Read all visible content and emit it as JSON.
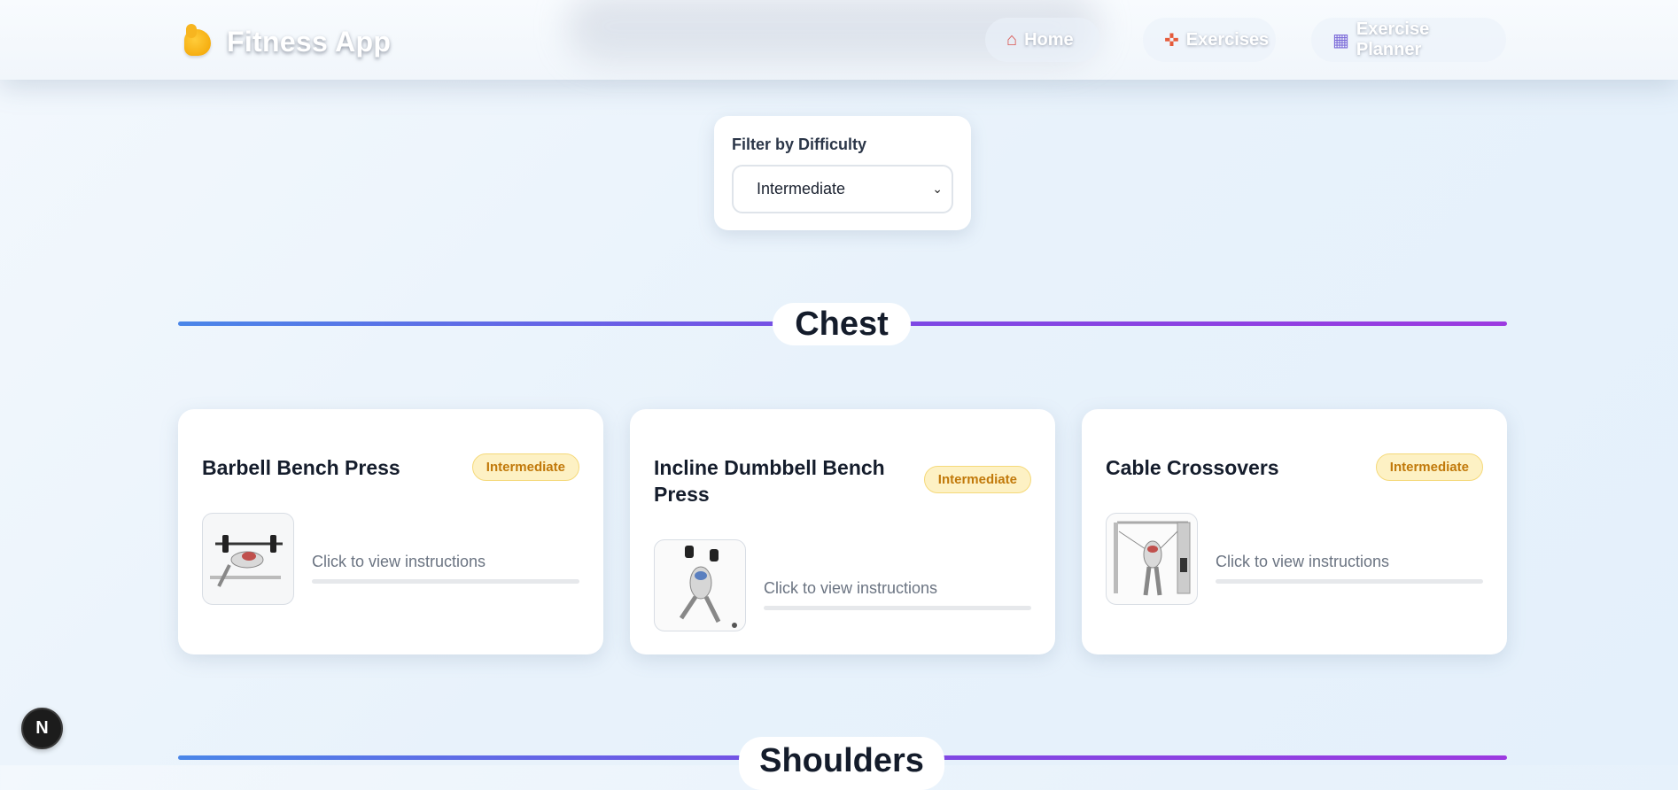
{
  "app": {
    "title": "Fitness App",
    "brand_icon": "flexed-biceps-icon"
  },
  "nav": {
    "items": [
      {
        "label": "Home",
        "icon": "house-icon"
      },
      {
        "label": "Exercises",
        "icon": "weightlifter-icon"
      },
      {
        "label": "Exercise Planner",
        "icon": "calendar-icon"
      }
    ]
  },
  "filter": {
    "label": "Filter by Difficulty",
    "selected": "Intermediate"
  },
  "sections": [
    {
      "title": "Chest",
      "exercises": [
        {
          "name": "Barbell Bench Press",
          "difficulty": "Intermediate",
          "hint": "Click to view instructions"
        },
        {
          "name": "Incline Dumbbell Bench Press",
          "difficulty": "Intermediate",
          "hint": "Click to view instructions"
        },
        {
          "name": "Cable Crossovers",
          "difficulty": "Intermediate",
          "hint": "Click to view instructions"
        }
      ]
    },
    {
      "title": "Shoulders",
      "exercises": []
    }
  ],
  "dev_badge": {
    "label": "N"
  },
  "colors": {
    "badge_bg": "#fdf1c4",
    "badge_text": "#c1790a",
    "divider_start": "#4a86e8",
    "divider_end": "#9c3ae0"
  }
}
